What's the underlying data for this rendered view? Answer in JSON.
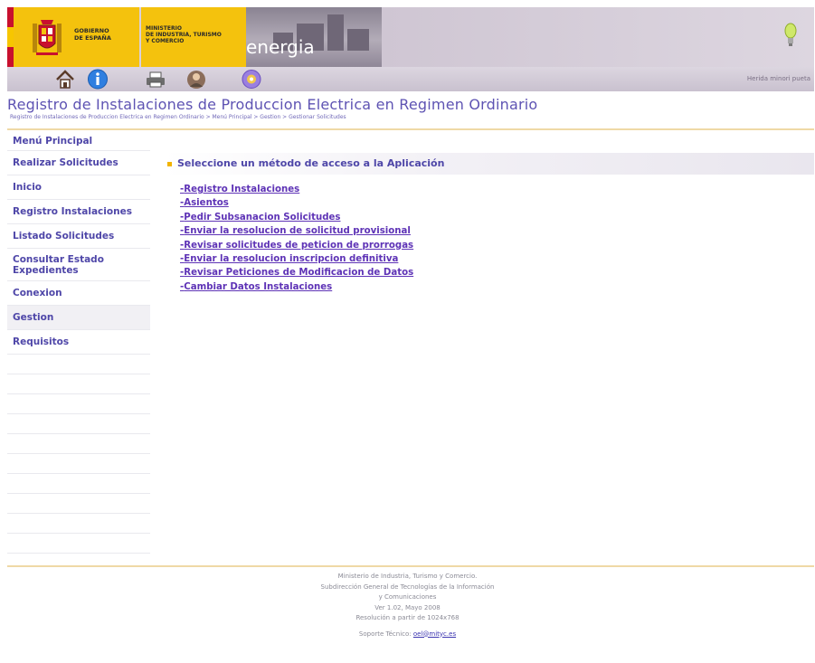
{
  "header": {
    "gobierno_text": "GOBIERNO\nDE ESPAÑA",
    "ministerio_text": "MINISTERIO\nDE INDUSTRIA, TURISMO\nY COMERCIO",
    "energia_text": "energia"
  },
  "toolbar": {
    "icons": [
      "home-icon",
      "info-icon",
      "print-icon",
      "help-person-icon",
      "contact-globe-icon"
    ],
    "right_text": "Herida minori pueta"
  },
  "page": {
    "title": "Registro de Instalaciones de Produccion Electrica en Regimen Ordinario",
    "breadcrumb": "Registro de Instalaciones de Produccion Electrica en Regimen Ordinario > Menú Principal > Gestion > Gestionar Solicitudes"
  },
  "sidebar": {
    "items": [
      {
        "label": "Menú Principal"
      },
      {
        "label": "Realizar Solicitudes"
      },
      {
        "label": "Inicio"
      },
      {
        "label": "Registro Instalaciones"
      },
      {
        "label": "Listado Solicitudes"
      },
      {
        "label": "Consultar Estado Expedientes"
      },
      {
        "label": "Conexion"
      },
      {
        "label": "Gestion"
      },
      {
        "label": "Requisitos"
      }
    ]
  },
  "main": {
    "section_title": "Seleccione un método de acceso a la Aplicación",
    "links": [
      {
        "label": "Registro Instalaciones"
      },
      {
        "label": "Asientos"
      },
      {
        "label": "Pedir Subsanacion Solicitudes"
      },
      {
        "label": "Enviar la resolucion de solicitud provisional"
      },
      {
        "label": "Revisar solicitudes de peticion de prorrogas"
      },
      {
        "label": "Enviar la resolucion inscripcion definitiva"
      },
      {
        "label": "Revisar Peticiones de Modificacion de Datos"
      },
      {
        "label": "Cambiar Datos Instalaciones"
      }
    ]
  },
  "footer": {
    "line1": "Ministerio de Industria, Turismo y Comercio.",
    "line2": "Subdirección General de Tecnologías de la Información",
    "line3": "y Comunicaciones",
    "line4": "Ver 1.02, Mayo 2008",
    "line5": "Resolución a partir de 1024x768",
    "support_label": "Soporte Técnico:",
    "support_email": "oel@mityc.es"
  },
  "colors": {
    "accent": "#4e46a8",
    "link": "#5e33b6",
    "banner_yellow": "#f4c20d",
    "rule": "#efd9a6"
  }
}
